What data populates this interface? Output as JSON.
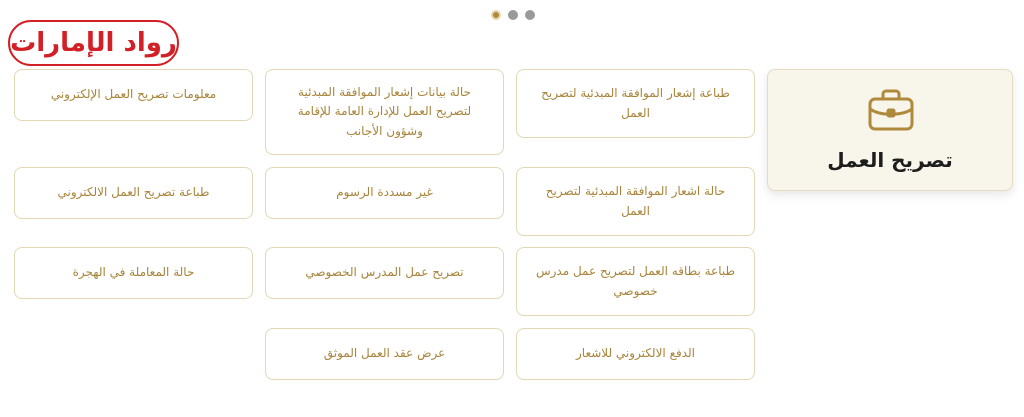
{
  "logo": {
    "text": "رواد الإمارات"
  },
  "carousel": {
    "pages": 3,
    "active": 1
  },
  "category": {
    "title": "تصريح العمل",
    "icon": "briefcase-icon"
  },
  "colors": {
    "accent": "#b08a3c",
    "logo_red": "#d32027",
    "card_border": "#e3d7b6",
    "main_card_bg": "#f8f5eb"
  },
  "services": {
    "r1c1": "طباعة إشعار الموافقة المبدئية لتصريح العمل",
    "r1c2": "حالة بيانات إشعار الموافقة المبدئية لتصريح العمل للإدارة العامة للإقامة وشؤون الأجانب",
    "r1c3": "معلومات تصريح العمل الإلكتروني",
    "r2c1": "حالة اشعار الموافقة المبدئية لتصريح العمل",
    "r2c2": "غير مسددة الرسوم",
    "r2c3": "طباعة تصريح العمل الالكتروني",
    "r3c1": "طباعة بطاقه العمل لتصريح عمل مدرس خصوصي",
    "r3c2": "تصريح عمل المدرس الخصوصي",
    "r3c3": "حالة المعاملة في الهجرة",
    "r4c1": "الدفع الالكتروني للاشعار",
    "r4c2": "عرض عقد العمل الموثق"
  }
}
